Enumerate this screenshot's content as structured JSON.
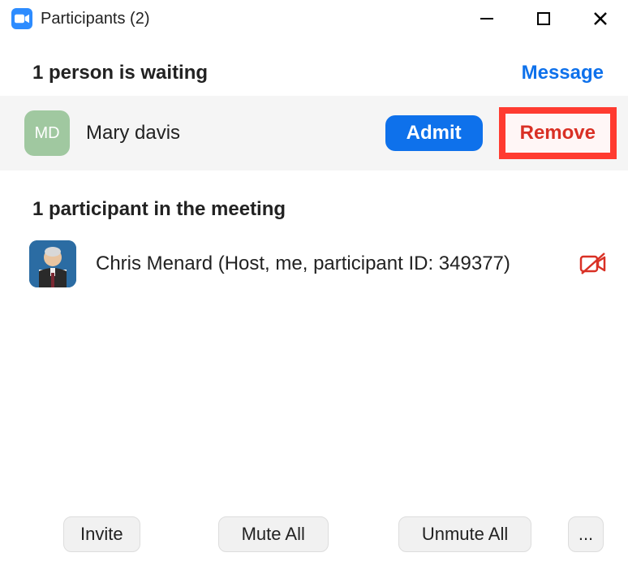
{
  "window": {
    "title": "Participants (2)"
  },
  "waiting": {
    "header": "1 person is waiting",
    "message_label": "Message",
    "person": {
      "initials": "MD",
      "name": "Mary davis"
    },
    "admit_label": "Admit",
    "remove_label": "Remove"
  },
  "meeting": {
    "header": "1 participant in the meeting",
    "participant": {
      "name": "Chris Menard (Host, me, participant ID: 349377)"
    }
  },
  "footer": {
    "invite_label": "Invite",
    "mute_all_label": "Mute All",
    "unmute_all_label": "Unmute All",
    "more_label": "..."
  }
}
